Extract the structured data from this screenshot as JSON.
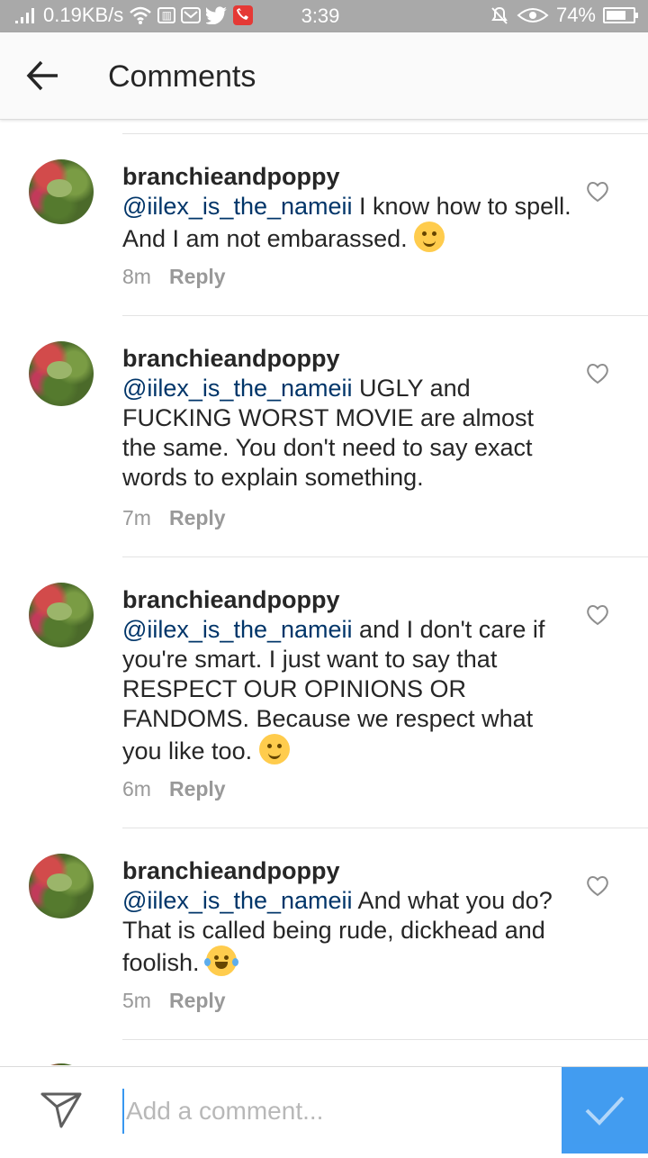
{
  "status_bar": {
    "net_speed": "0.19KB/s",
    "time": "3:39",
    "battery": "74%",
    "battery_level": 0.74,
    "icons": [
      "signal-icon",
      "wifi-icon",
      "app-notification-icon",
      "mail-icon",
      "twitter-icon",
      "missed-call-icon",
      "silent-icon",
      "eye-icon",
      "battery-icon"
    ]
  },
  "header": {
    "title": "Comments",
    "back_icon": "arrow-left-icon"
  },
  "comments": [
    {
      "username": "branchieandpoppy",
      "mention": "@iilex_is_the_nameii",
      "text": " I know how to spell. And I am not embarassed. ",
      "emoji": "smiling-face-icon",
      "time": "8m",
      "reply_label": "Reply"
    },
    {
      "username": "branchieandpoppy",
      "mention": "@iilex_is_the_nameii",
      "text": " UGLY and FUCKING WORST MOVIE are almost the same. You don't need to say exact words to explain something.",
      "emoji": "",
      "time": "7m",
      "reply_label": "Reply"
    },
    {
      "username": "branchieandpoppy",
      "mention": "@iilex_is_the_nameii",
      "text": " and I don't care if you're smart. I just want to say that RESPECT OUR OPINIONS OR FANDOMS. Because we respect what you like too. ",
      "emoji": "winking-face-icon",
      "time": "6m",
      "reply_label": "Reply"
    },
    {
      "username": "branchieandpoppy",
      "mention": "@iilex_is_the_nameii",
      "text": " And what you do? That is called being rude, dickhead and foolish. ",
      "emoji": "tears-of-joy-icon",
      "time": "5m",
      "reply_label": "Reply"
    }
  ],
  "composer": {
    "placeholder": "Add a comment...",
    "value": ""
  },
  "colors": {
    "accent": "#3897f0",
    "mention": "#003569",
    "status_bar": "#a9a9a9",
    "meta": "#999999"
  }
}
